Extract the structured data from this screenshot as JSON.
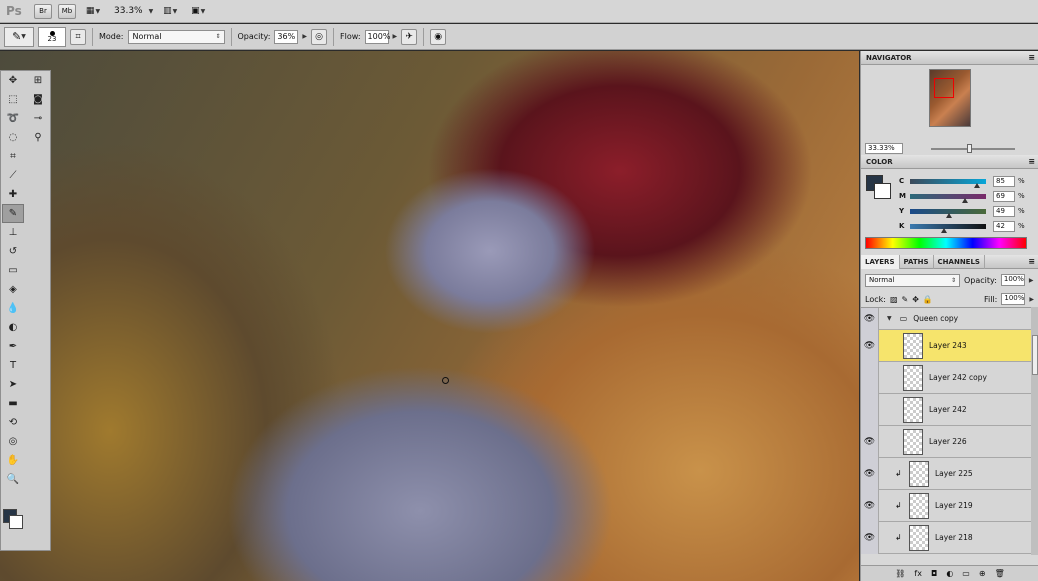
{
  "appbar": {
    "logo": "Ps",
    "bridge_label": "Br",
    "minibridge_label": "Mb",
    "zoom": "33.3%"
  },
  "options": {
    "brush_size": "23",
    "mode_label": "Mode:",
    "mode_value": "Normal",
    "opacity_label": "Opacity:",
    "opacity_value": "36%",
    "flow_label": "Flow:",
    "flow_value": "100%"
  },
  "navigator": {
    "title": "NAVIGATOR",
    "zoom": "33.33%"
  },
  "color": {
    "title": "COLOR",
    "foreground": "#263546",
    "channels": [
      {
        "label": "C",
        "value": "85",
        "unit": "%"
      },
      {
        "label": "M",
        "value": "69",
        "unit": "%"
      },
      {
        "label": "Y",
        "value": "49",
        "unit": "%"
      },
      {
        "label": "K",
        "value": "42",
        "unit": "%"
      }
    ]
  },
  "layers_panel": {
    "tabs": [
      "LAYERS",
      "PATHS",
      "CHANNELS"
    ],
    "blend_mode": "Normal",
    "opacity_label": "Opacity:",
    "opacity_value": "100%",
    "lock_label": "Lock:",
    "fill_label": "Fill:",
    "fill_value": "100%",
    "group_name": "Queen copy",
    "layers": [
      {
        "name": "Layer 243",
        "visible": true,
        "selected": true,
        "clipped": false
      },
      {
        "name": "Layer 242 copy",
        "visible": false,
        "selected": false,
        "clipped": false
      },
      {
        "name": "Layer 242",
        "visible": false,
        "selected": false,
        "clipped": false
      },
      {
        "name": "Layer 226",
        "visible": true,
        "selected": false,
        "clipped": false
      },
      {
        "name": "Layer 225",
        "visible": true,
        "selected": false,
        "clipped": true
      },
      {
        "name": "Layer 219",
        "visible": true,
        "selected": false,
        "clipped": true
      },
      {
        "name": "Layer 218",
        "visible": true,
        "selected": false,
        "clipped": true
      }
    ]
  }
}
